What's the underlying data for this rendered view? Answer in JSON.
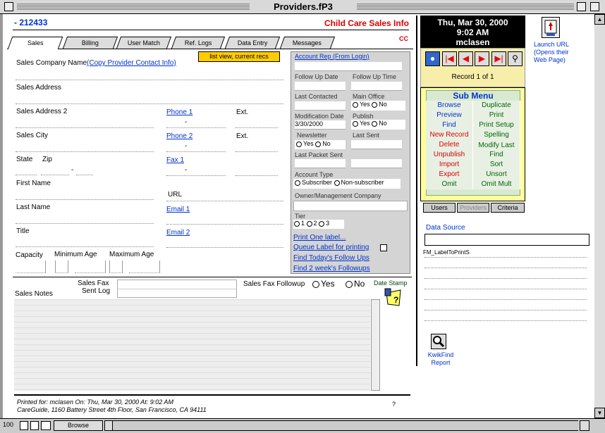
{
  "window": {
    "title": "Providers.fP3"
  },
  "header": {
    "record_id": "- 212433",
    "app_title": "Child Care Sales Info",
    "cc": "CC"
  },
  "tabs": [
    "Sales",
    "Billing",
    "User Match",
    "Ref. Logs",
    "Data Entry",
    "Messages"
  ],
  "list_view_button": "list view, current recs",
  "form": {
    "company_label": "Sales Company Name",
    "copy_link": "(Copy Provider Contact Info)",
    "address": "Sales Address",
    "address2": "Sales Address 2",
    "city": "Sales City",
    "state": "State",
    "zip": "Zip",
    "first_name": "First Name",
    "last_name": "Last Name",
    "title": "Title",
    "capacity": "Capacity",
    "min_age": "Minimum Age",
    "max_age": "Maximum Age",
    "phone1": "Phone 1",
    "phone2": "Phone 2",
    "fax1": "Fax 1",
    "ext1": "Ext.",
    "ext2": "Ext.",
    "url": "URL",
    "email1": "Email 1",
    "email2": "Email 2",
    "dash": "-"
  },
  "gray_panel": {
    "account_rep": "Account Rep (From Login)",
    "follow_up_date": "Follow Up Date",
    "follow_up_time": "Follow Up Time",
    "last_contacted": "Last Contacted",
    "main_office": "Main Office",
    "yes": "Yes",
    "no": "No",
    "mod_date": "Modification Date",
    "mod_date_value": "3/30/2000",
    "publish": "Publish",
    "newsletter": "Newsletter",
    "last_sent": "Last Sent",
    "last_packet_sent": "Last Packet Sent",
    "account_type": "Account Type",
    "subscriber": "Subscriber",
    "non_subscriber": "Non-subscriber",
    "owner_mgmt": "Owner/Management Company",
    "tier": "Tier",
    "tier1": "1",
    "tier2": "2",
    "tier3": "3",
    "print_label": "Print One label...",
    "queue_label": "Queue Label for printing",
    "find_today": "Find Today's Follow Ups",
    "find_2week": "Find 2 week's Followups"
  },
  "notes": {
    "sales_fax": "Sales Fax",
    "sent_log": "Sent Log",
    "sales_notes": "Sales Notes",
    "fax_followup": "Sales Fax Followup",
    "yes": "Yes",
    "no": "No",
    "date_stamp": "Date Stamp"
  },
  "footer": {
    "printed": "Printed for: mclasen  On: Thu, Mar 30, 2000   At: 9:02 AM",
    "address": "CareGuide, 1160 Battery Street 4th Floor, San Francisco, CA 94111",
    "question": "?"
  },
  "right_panel": {
    "date": "Thu, Mar 30, 2000",
    "time": "9:02 AM",
    "user": "mclasen",
    "record_status": "Record 1 of 1",
    "sub_menu_title": "Sub Menu",
    "sub_menu": [
      [
        "Browse",
        "Duplicate"
      ],
      [
        "Preview",
        "Print"
      ],
      [
        "Find",
        "Print Setup"
      ],
      [
        "New Record",
        "Spelling"
      ],
      [
        "Delete",
        "Modify Last Find"
      ],
      [
        "Unpublish",
        ""
      ],
      [
        "Import",
        "Sort"
      ],
      [
        "Export",
        "Unsort"
      ],
      [
        "Omit",
        "Omit Mult"
      ]
    ],
    "mini_tabs": [
      "Users",
      "Providers",
      "Criteria"
    ],
    "data_source": "Data Source",
    "fm_label": "FM_LabelToPrintS",
    "kwikfind": "KwikFind Report",
    "launch_url": "Launch URL (Opens their Web Page)"
  },
  "status_bar": {
    "zoom": "100",
    "mode": "Browse"
  }
}
